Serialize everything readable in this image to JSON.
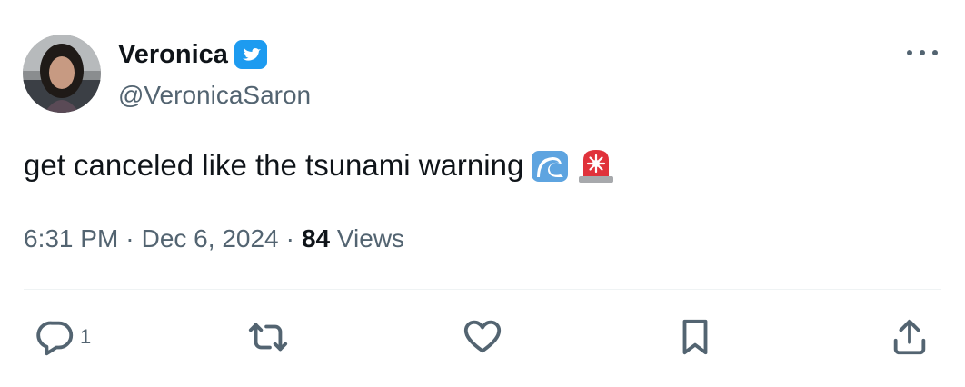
{
  "tweet": {
    "author": {
      "display_name": "Veronica",
      "handle": "@VeronicaSaron",
      "verified": true,
      "verified_color": "#1d9bf0"
    },
    "text": "get canceled like the tsunami warning",
    "emojis": [
      "water-wave",
      "rotating-light"
    ],
    "timestamp": "6:31 PM",
    "separator": "·",
    "date": "Dec 6, 2024",
    "views_count": "84",
    "views_label": "Views",
    "actions": {
      "reply_count": "1"
    }
  },
  "colors": {
    "text_primary": "#0f1419",
    "text_secondary": "#536471",
    "divider": "#eff3f4",
    "icon": "#536471"
  }
}
